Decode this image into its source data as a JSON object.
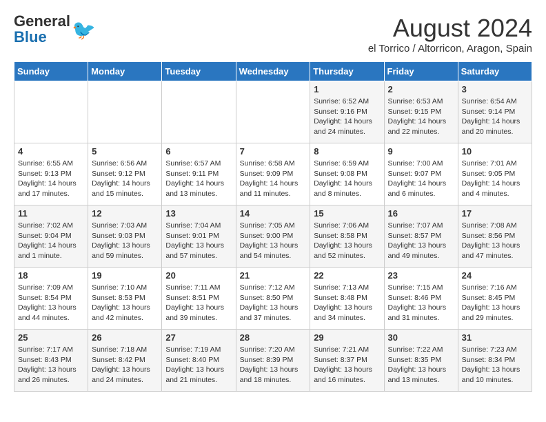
{
  "header": {
    "logo_general": "General",
    "logo_blue": "Blue",
    "title": "August 2024",
    "subtitle": "el Torrico / Altorricon, Aragon, Spain"
  },
  "weekdays": [
    "Sunday",
    "Monday",
    "Tuesday",
    "Wednesday",
    "Thursday",
    "Friday",
    "Saturday"
  ],
  "weeks": [
    [
      {
        "day": "",
        "text": ""
      },
      {
        "day": "",
        "text": ""
      },
      {
        "day": "",
        "text": ""
      },
      {
        "day": "",
        "text": ""
      },
      {
        "day": "1",
        "text": "Sunrise: 6:52 AM\nSunset: 9:16 PM\nDaylight: 14 hours\nand 24 minutes."
      },
      {
        "day": "2",
        "text": "Sunrise: 6:53 AM\nSunset: 9:15 PM\nDaylight: 14 hours\nand 22 minutes."
      },
      {
        "day": "3",
        "text": "Sunrise: 6:54 AM\nSunset: 9:14 PM\nDaylight: 14 hours\nand 20 minutes."
      }
    ],
    [
      {
        "day": "4",
        "text": "Sunrise: 6:55 AM\nSunset: 9:13 PM\nDaylight: 14 hours\nand 17 minutes."
      },
      {
        "day": "5",
        "text": "Sunrise: 6:56 AM\nSunset: 9:12 PM\nDaylight: 14 hours\nand 15 minutes."
      },
      {
        "day": "6",
        "text": "Sunrise: 6:57 AM\nSunset: 9:11 PM\nDaylight: 14 hours\nand 13 minutes."
      },
      {
        "day": "7",
        "text": "Sunrise: 6:58 AM\nSunset: 9:09 PM\nDaylight: 14 hours\nand 11 minutes."
      },
      {
        "day": "8",
        "text": "Sunrise: 6:59 AM\nSunset: 9:08 PM\nDaylight: 14 hours\nand 8 minutes."
      },
      {
        "day": "9",
        "text": "Sunrise: 7:00 AM\nSunset: 9:07 PM\nDaylight: 14 hours\nand 6 minutes."
      },
      {
        "day": "10",
        "text": "Sunrise: 7:01 AM\nSunset: 9:05 PM\nDaylight: 14 hours\nand 4 minutes."
      }
    ],
    [
      {
        "day": "11",
        "text": "Sunrise: 7:02 AM\nSunset: 9:04 PM\nDaylight: 14 hours\nand 1 minute."
      },
      {
        "day": "12",
        "text": "Sunrise: 7:03 AM\nSunset: 9:03 PM\nDaylight: 13 hours\nand 59 minutes."
      },
      {
        "day": "13",
        "text": "Sunrise: 7:04 AM\nSunset: 9:01 PM\nDaylight: 13 hours\nand 57 minutes."
      },
      {
        "day": "14",
        "text": "Sunrise: 7:05 AM\nSunset: 9:00 PM\nDaylight: 13 hours\nand 54 minutes."
      },
      {
        "day": "15",
        "text": "Sunrise: 7:06 AM\nSunset: 8:58 PM\nDaylight: 13 hours\nand 52 minutes."
      },
      {
        "day": "16",
        "text": "Sunrise: 7:07 AM\nSunset: 8:57 PM\nDaylight: 13 hours\nand 49 minutes."
      },
      {
        "day": "17",
        "text": "Sunrise: 7:08 AM\nSunset: 8:56 PM\nDaylight: 13 hours\nand 47 minutes."
      }
    ],
    [
      {
        "day": "18",
        "text": "Sunrise: 7:09 AM\nSunset: 8:54 PM\nDaylight: 13 hours\nand 44 minutes."
      },
      {
        "day": "19",
        "text": "Sunrise: 7:10 AM\nSunset: 8:53 PM\nDaylight: 13 hours\nand 42 minutes."
      },
      {
        "day": "20",
        "text": "Sunrise: 7:11 AM\nSunset: 8:51 PM\nDaylight: 13 hours\nand 39 minutes."
      },
      {
        "day": "21",
        "text": "Sunrise: 7:12 AM\nSunset: 8:50 PM\nDaylight: 13 hours\nand 37 minutes."
      },
      {
        "day": "22",
        "text": "Sunrise: 7:13 AM\nSunset: 8:48 PM\nDaylight: 13 hours\nand 34 minutes."
      },
      {
        "day": "23",
        "text": "Sunrise: 7:15 AM\nSunset: 8:46 PM\nDaylight: 13 hours\nand 31 minutes."
      },
      {
        "day": "24",
        "text": "Sunrise: 7:16 AM\nSunset: 8:45 PM\nDaylight: 13 hours\nand 29 minutes."
      }
    ],
    [
      {
        "day": "25",
        "text": "Sunrise: 7:17 AM\nSunset: 8:43 PM\nDaylight: 13 hours\nand 26 minutes."
      },
      {
        "day": "26",
        "text": "Sunrise: 7:18 AM\nSunset: 8:42 PM\nDaylight: 13 hours\nand 24 minutes."
      },
      {
        "day": "27",
        "text": "Sunrise: 7:19 AM\nSunset: 8:40 PM\nDaylight: 13 hours\nand 21 minutes."
      },
      {
        "day": "28",
        "text": "Sunrise: 7:20 AM\nSunset: 8:39 PM\nDaylight: 13 hours\nand 18 minutes."
      },
      {
        "day": "29",
        "text": "Sunrise: 7:21 AM\nSunset: 8:37 PM\nDaylight: 13 hours\nand 16 minutes."
      },
      {
        "day": "30",
        "text": "Sunrise: 7:22 AM\nSunset: 8:35 PM\nDaylight: 13 hours\nand 13 minutes."
      },
      {
        "day": "31",
        "text": "Sunrise: 7:23 AM\nSunset: 8:34 PM\nDaylight: 13 hours\nand 10 minutes."
      }
    ]
  ]
}
